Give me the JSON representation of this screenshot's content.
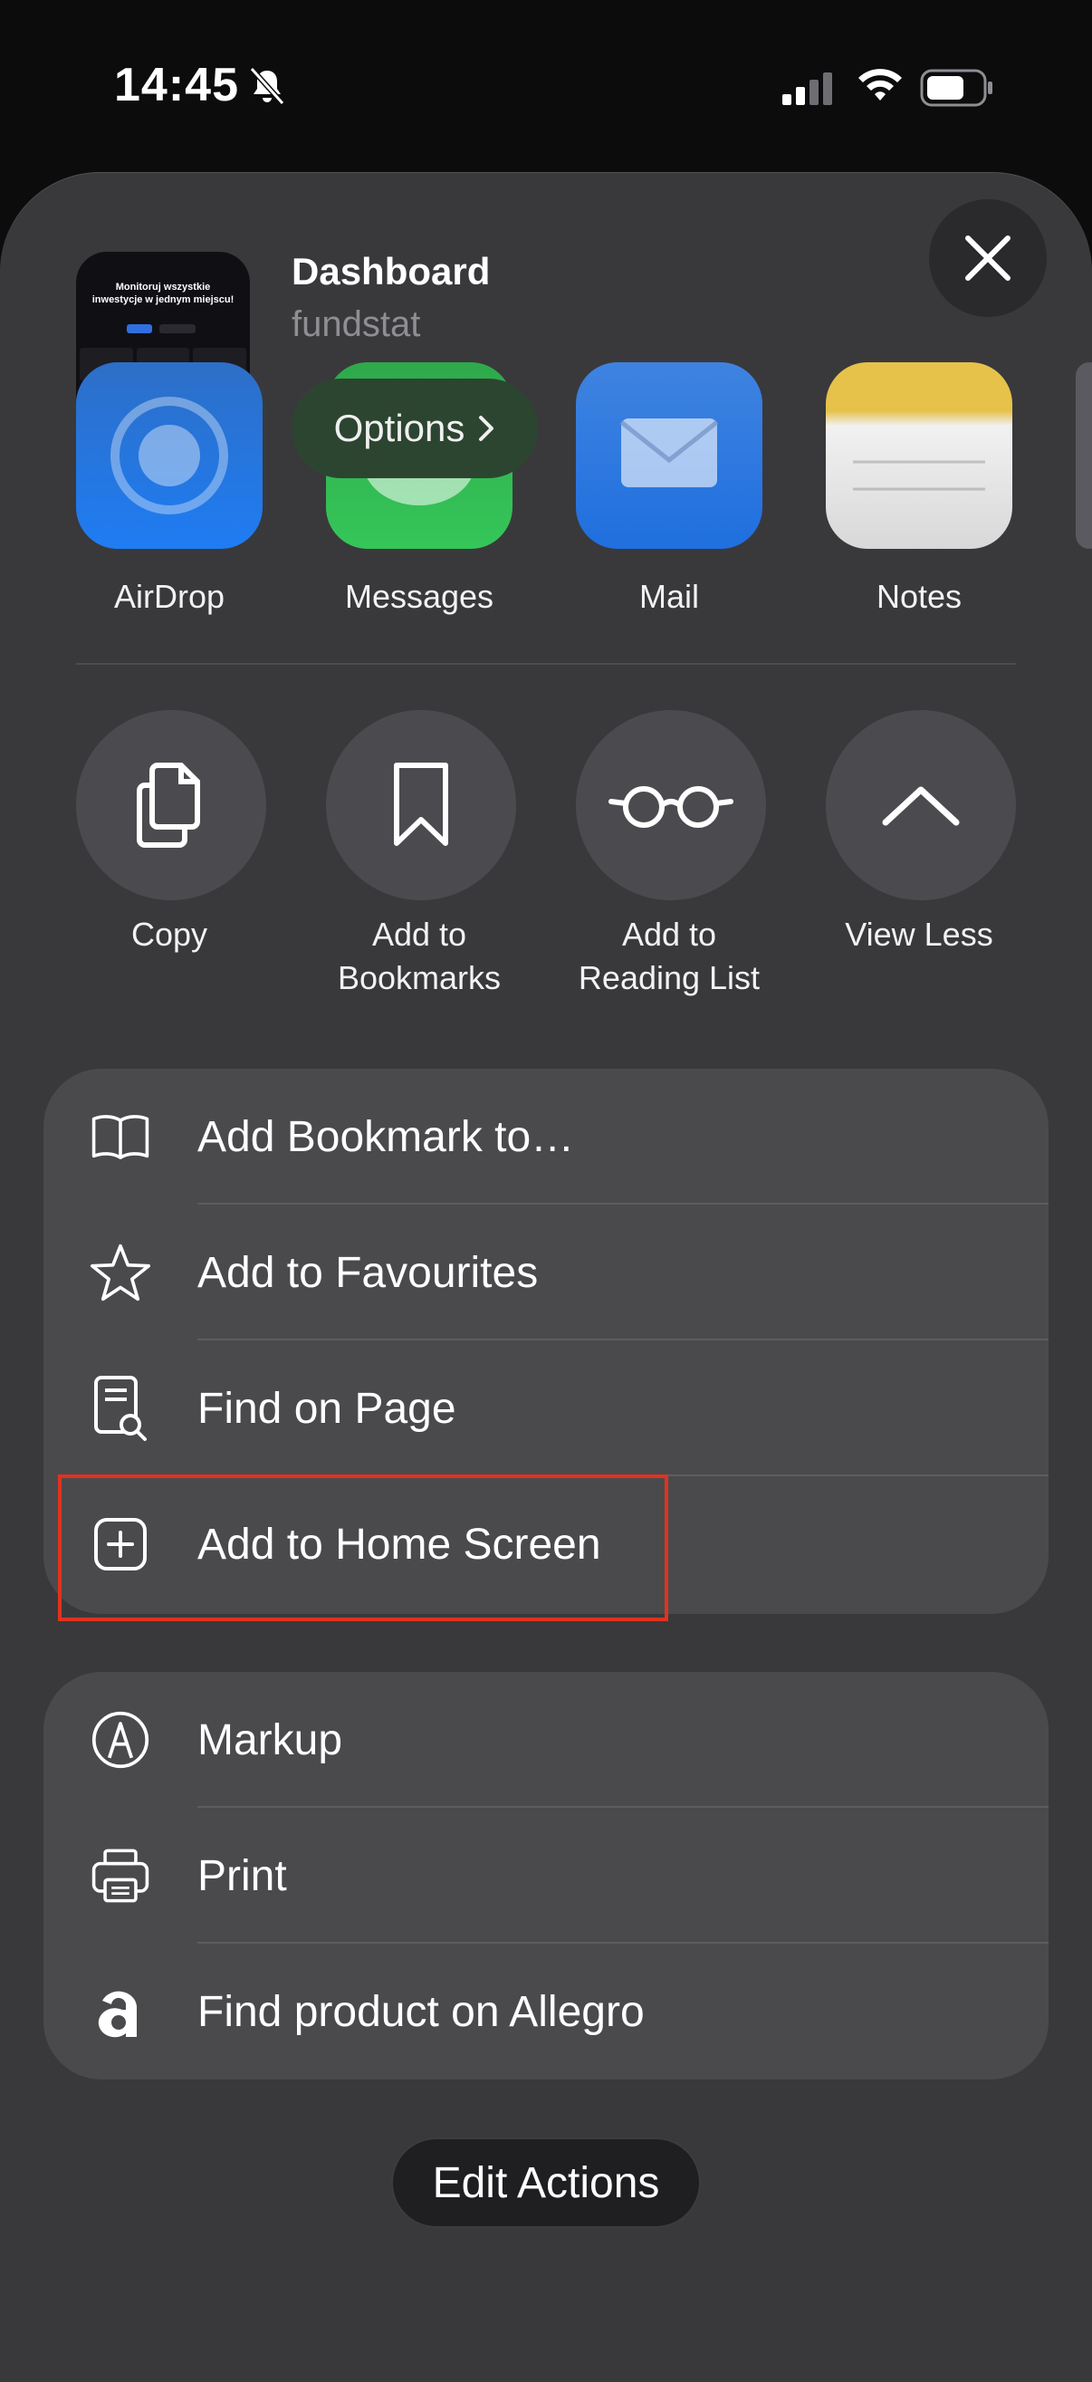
{
  "status_bar": {
    "time": "14:45"
  },
  "header": {
    "title": "Dashboard",
    "subtitle": "fundstat",
    "options_label": "Options",
    "thumbnail_text": "Monitoruj wszystkie inwestycje w jednym miejscu!"
  },
  "share_targets": [
    {
      "label": "AirDrop",
      "icon": "airdrop-icon",
      "color": "#1f7cf3"
    },
    {
      "label": "Messages",
      "icon": "messages-icon",
      "color": "#35c659"
    },
    {
      "label": "Mail",
      "icon": "mail-icon",
      "color": "#1f7cf3"
    },
    {
      "label": "Notes",
      "icon": "notes-icon",
      "color": "#f4d24a"
    }
  ],
  "quick_actions": [
    {
      "label": "Copy",
      "icon": "copy-icon"
    },
    {
      "label": "Add to Bookmarks",
      "icon": "bookmark-icon"
    },
    {
      "label": "Add to Reading List",
      "icon": "glasses-icon"
    },
    {
      "label": "View Less",
      "icon": "chevron-up-icon"
    }
  ],
  "menu_group_1": [
    {
      "label": "Add Bookmark to…",
      "icon": "book-icon"
    },
    {
      "label": "Add to Favourites",
      "icon": "star-icon"
    },
    {
      "label": "Find on Page",
      "icon": "find-on-page-icon"
    },
    {
      "label": "Add to Home Screen",
      "icon": "add-square-icon"
    }
  ],
  "menu_group_2": [
    {
      "label": "Markup",
      "icon": "markup-icon"
    },
    {
      "label": "Print",
      "icon": "printer-icon"
    },
    {
      "label": "Find product on Allegro",
      "icon": "allegro-icon"
    }
  ],
  "edit_actions_label": "Edit Actions",
  "highlight_color": "#e0331f"
}
